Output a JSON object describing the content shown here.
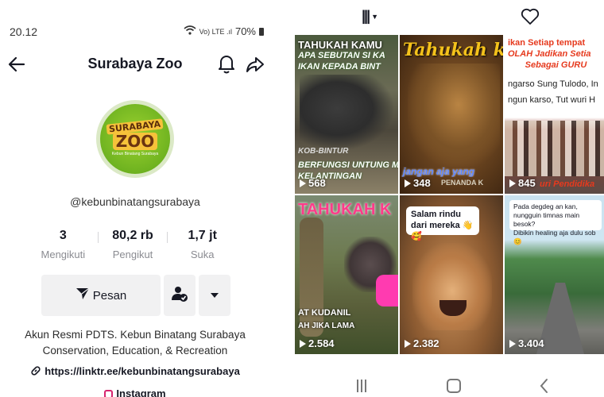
{
  "status_bar": {
    "time": "20.12",
    "signal": "Vo) LTE .ıl",
    "battery": "70%"
  },
  "header": {
    "title": "Surabaya Zoo"
  },
  "profile": {
    "avatar_text_top": "SURABAYA",
    "avatar_text_main": "ZOO",
    "avatar_text_sub": "Kebun Binatang Surabaya",
    "handle": "@kebunbinatangsurabaya",
    "stats": [
      {
        "value": "3",
        "label": "Mengikuti"
      },
      {
        "value": "80,2 rb",
        "label": "Pengikut"
      },
      {
        "value": "1,7 jt",
        "label": "Suka"
      }
    ],
    "message_button": "Pesan",
    "bio_line1": "Akun Resmi PDTS. Kebun Binatang Surabaya",
    "bio_line2": "Conservation, Education, & Recreation",
    "link": "https://linktr.ee/kebunbinatangsurabaya",
    "instagram": "Instagram"
  },
  "videos": [
    {
      "views": "568",
      "captions": [
        "TAHUKAH KAMU",
        "APA SEBUTAN SI KA",
        "IKAN KEPADA BINT",
        "KOB-BINTUR",
        "BERFUNGSI UNTUNG MEMB",
        "KELANTINGAN"
      ]
    },
    {
      "views": "348",
      "captions": [
        "Tahukah kamu",
        "jangan aja yang",
        "PENANDA K"
      ]
    },
    {
      "views": "845",
      "captions": [
        "ikan Setiap tempat",
        "OLAH Jadikan Setia",
        "Sebagai GURU",
        "ngarso Sung Tulodo, In",
        "ngun karso, Tut wuri H",
        "uri Pendidika"
      ]
    },
    {
      "views": "2.584",
      "captions": [
        "TAHUKAH K",
        "AT KUDANIL",
        "AH JIKA LAMA"
      ]
    },
    {
      "views": "2.382",
      "captions": [
        "Salam rindu",
        "dari mereka 👋🥰"
      ]
    },
    {
      "views": "3.404",
      "captions": [
        "Pada degdeg an kan,",
        "nungguin timnas main besok?",
        "Dibikin healing aja dulu sob 😊"
      ]
    }
  ]
}
